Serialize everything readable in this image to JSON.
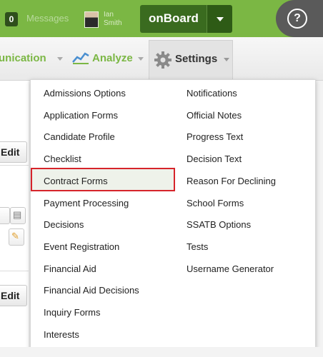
{
  "topbar": {
    "messages_count": "0",
    "messages_label": "Messages",
    "user_name_first": "Ian",
    "user_name_last": "Smith",
    "app_switch_label": "onBoard",
    "help_label": "?"
  },
  "nav": {
    "communication_label": "unication",
    "analyze_label": "Analyze",
    "settings_label": "Settings"
  },
  "background": {
    "edit_label": "Edit",
    "edit_label_2": "Edit"
  },
  "settings_menu": {
    "left_items": [
      "Admissions Options",
      "Application Forms",
      "Candidate Profile",
      "Checklist",
      "Contract Forms",
      "Payment Processing",
      "Decisions",
      "Event Registration",
      "Financial Aid",
      "Financial Aid Decisions",
      "Inquiry Forms",
      "Interests"
    ],
    "right_items": [
      "Notifications",
      "Official Notes",
      "Progress Text",
      "Decision Text",
      "Reason For Declining",
      "School Forms",
      "SSATB Options",
      "Tests",
      "Username Generator"
    ],
    "highlighted_item": "Contract Forms"
  },
  "colors": {
    "brand_green": "#7bb744",
    "dark_green": "#3a6b1f",
    "highlight_red": "#d6242a"
  }
}
